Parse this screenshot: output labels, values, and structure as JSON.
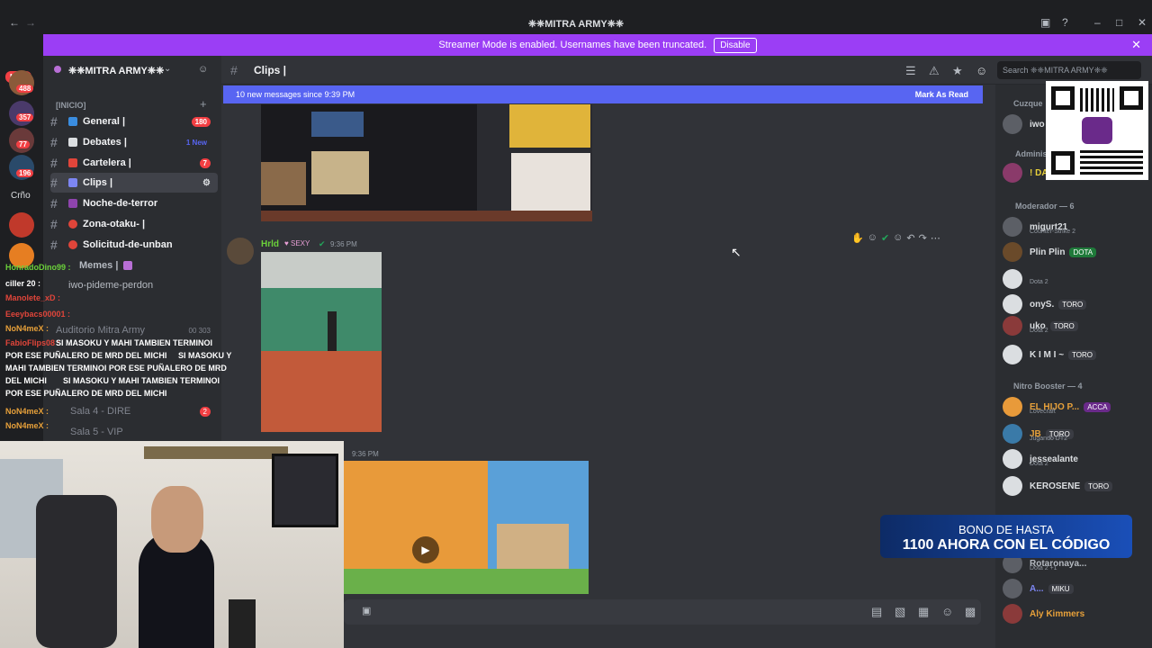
{
  "window": {
    "title": "❈❈MITRA ARMY❈❈"
  },
  "banner": {
    "text": "Streamer Mode is enabled. Usernames have been truncated.",
    "disable_label": "Disable"
  },
  "guilds": {
    "new_label": "NEW",
    "badges": [
      "488",
      "357",
      "77",
      "196"
    ],
    "folder_label": "Crño"
  },
  "server": {
    "name": "❈❈MITRA ARMY❈❈",
    "category": "[INICIO]"
  },
  "channels": [
    {
      "label": "General |",
      "badge": "180"
    },
    {
      "label": "Debates |",
      "badge": "1 New"
    },
    {
      "label": "Cartelera |",
      "badge": "7"
    },
    {
      "label": "Clips |",
      "badge": ""
    },
    {
      "label": "Noche-de-terror",
      "badge": ""
    },
    {
      "label": "Zona-otaku- |",
      "badge": ""
    },
    {
      "label": "Solicitud-de-unban",
      "badge": ""
    },
    {
      "label": "Memes |",
      "badge": ""
    },
    {
      "label": "iwo-pideme-perdon",
      "badge": ""
    }
  ],
  "voice": [
    {
      "label": "Auditorio Mitra Army",
      "count": "00 303"
    },
    {
      "label": "Sala 4 - DIRE",
      "count": "2"
    },
    {
      "label": "Sala 5 - VIP",
      "count": ""
    }
  ],
  "overlay_chat": [
    {
      "user": "HonradoDino99 :",
      "text": "",
      "color": "#6bd13a"
    },
    {
      "user": "ciller 20 :",
      "text": "",
      "color": "#ffffff"
    },
    {
      "user": "Manolete_xD :",
      "text": "",
      "color": "#e0453a"
    },
    {
      "user": "Eeeybacs00001 :",
      "text": "",
      "color": "#e0453a"
    },
    {
      "user": "NoN4meX :",
      "text": "",
      "color": "#e8a13a"
    },
    {
      "user": "FabioFlips08 :",
      "text": "SI MASOKU Y MAHI TAMBIEN TERMINOI POR ESE PUÑALERO DE MRD DEL MICHI",
      "color": "#e0453a"
    },
    {
      "user": "NoN4meX :",
      "text": "",
      "color": "#e8a13a"
    },
    {
      "user": "NoN4meX :",
      "text": "",
      "color": "#e8a13a"
    }
  ],
  "overlay_spam": [
    "SI MASOKU Y MAHI TAMBIEN TERMINOI",
    "POR ESE PUÑALERO DE MRD DEL MICHI",
    "SI MASOKU Y",
    "MAHI TAMBIEN TERMINOI POR ESE PUÑALERO DE MRD",
    "DEL MICHI",
    "SI MASOKU Y MAHI TAMBIEN TERMINOI",
    "POR ESE PUÑALERO DE MRD DEL MICHI"
  ],
  "header": {
    "channel": "Clips |",
    "search_placeholder": "Search ❈❈MITRA ARMY❈❈"
  },
  "newbar": {
    "text": "10 new messages since 9:39 PM",
    "mark_label": "Mark As Read"
  },
  "message": {
    "author": "Hrld",
    "role": "SEXY",
    "time": "9:36 PM",
    "time2": "9:36 PM"
  },
  "members": {
    "top_category": "Cuzque",
    "top_member": "iwo",
    "admin_category": "Administ",
    "admin_member": "! DA",
    "mod_category": "Moderador — 6",
    "mods": [
      {
        "name": "migurt21",
        "activity": "Counter-Strike 2",
        "tag": ""
      },
      {
        "name": "Plin Plin",
        "activity": "",
        "tag": "DOTA"
      },
      {
        "name": "",
        "activity": "Dota 2",
        "tag": ""
      },
      {
        "name": "onyS.",
        "activity": "",
        "tag": "TORO"
      },
      {
        "name": "uko",
        "activity": "Dota 2",
        "tag": "TORO"
      },
      {
        "name": "K I M I ~",
        "activity": "",
        "tag": "TORO"
      }
    ],
    "booster_category": "Nitro Booster — 4",
    "boosters": [
      {
        "name": "EL HIJO P...",
        "activity": "Lovecraft",
        "tag": "ACCA",
        "color": "#e8a13a"
      },
      {
        "name": "JB",
        "activity": "Jugando DT2",
        "tag": "TORO",
        "color": "#e8a13a"
      },
      {
        "name": "jessealante",
        "activity": "Dota 2",
        "tag": "",
        "color": "#f2f3f5"
      },
      {
        "name": "KEROSENE",
        "activity": "",
        "tag": "TORO",
        "color": "#f2f3f5"
      }
    ],
    "others": [
      {
        "name": "Rotaronaya...",
        "activity": "Dota 2 +1",
        "tag": ""
      },
      {
        "name": "A...",
        "activity": "",
        "tag": "MIKU"
      },
      {
        "name": "Aly Kimmers",
        "activity": "",
        "tag": ""
      }
    ]
  },
  "promo": {
    "line1": "BONO DE HASTA",
    "line2": "1100 AHORA CON EL CÓDIGO"
  },
  "colors": {
    "accent": "#5865f2",
    "banner": "#9b3ef5",
    "online": "#23a55a"
  }
}
